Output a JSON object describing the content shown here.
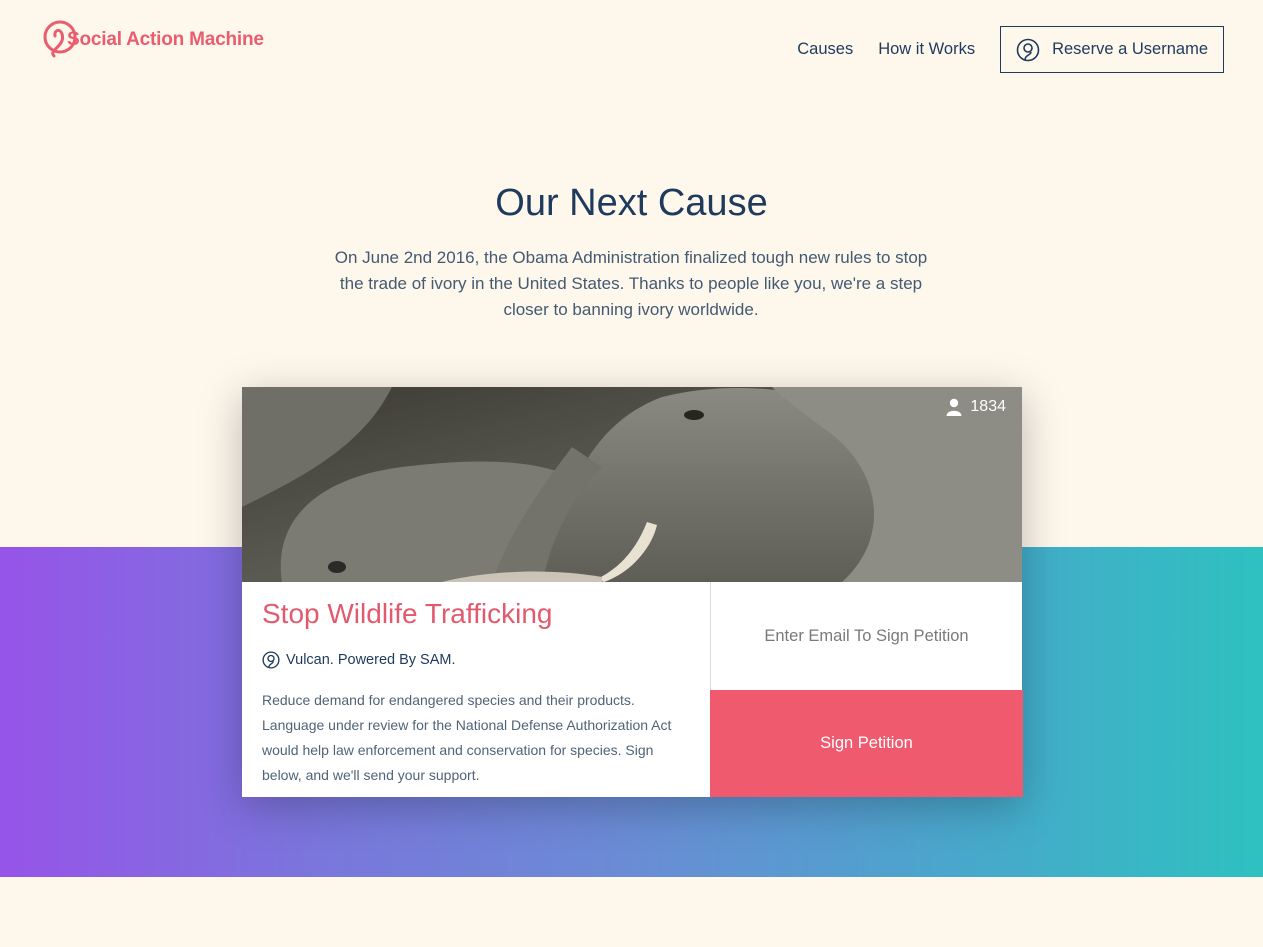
{
  "brand": {
    "name": "Social Action Machine",
    "color": "#ea5d6f"
  },
  "nav": {
    "items": [
      "Causes",
      "How it Works"
    ],
    "reserve_label": "Reserve a Username",
    "reserve_icon": "user-circle-icon"
  },
  "hero": {
    "title": "Our Next Cause",
    "text": "On June 2nd 2016, the Obama Administration finalized tough new rules to stop the trade of ivory in the United States. Thanks to people like you, we're a step closer to banning ivory worldwide."
  },
  "card": {
    "image": "elephants-photo",
    "supporter_count": "1834",
    "title": "Stop Wildlife Trafficking",
    "org": "Vulcan. Powered By SAM.",
    "description": "Reduce demand for endangered species and their products. Language under review for the National Defense Authorization Act would help law enforcement and conservation for species. Sign below, and we'll send your support.",
    "email_placeholder": "Enter Email To Sign Petition",
    "sign_label": "Sign Petition"
  },
  "colors": {
    "background": "#fef7ec",
    "navy": "#1e3a5c",
    "accent": "#f05a6e",
    "gradient_start": "#9654e8",
    "gradient_end": "#2ec1c0"
  }
}
